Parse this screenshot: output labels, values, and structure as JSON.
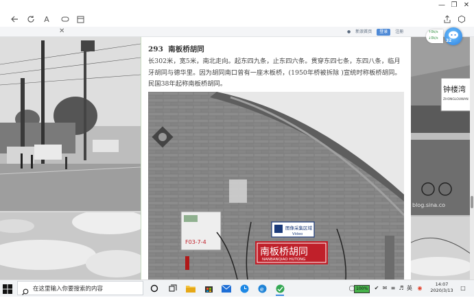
{
  "browser": {
    "toolbar_icons": [
      "back-icon",
      "refresh-icon",
      "read-aloud-icon",
      "vertical-tabs-icon",
      "tab-actions-icon",
      "share-icon",
      "extensions-icon"
    ],
    "text_size_glyph": "A"
  },
  "site_nav": {
    "home": "新浪首页",
    "login": "登录",
    "register": "注册"
  },
  "net_speed": {
    "up": "0k/s",
    "down": "0k/s"
  },
  "assistant_badge": "32",
  "article": {
    "number": "293",
    "title": "南板桥胡同",
    "body": "长302米，宽5米，南北走向。起东四九条，止东四六条。贯穿东四七条，东四八条，临月牙胡同与德华里。因为胡同南口曾有一座木板桥，(1950年桥被拆除 )宣统时称板桥胡同。民国38年起称南板桥胡同。"
  },
  "photo_text": {
    "sign_main": "南板桥胡同",
    "sign_pinyin": "NANBANQIAO HUTONG",
    "camera_notice": "图像采集区域",
    "camera_sub": "Video",
    "meter_label": "F03-7-4",
    "right_sign": "钟楼湾",
    "right_sign_pinyin": "ZHONGLOUWAN",
    "watermark": "blog.sina.co"
  },
  "taskbar": {
    "search_placeholder": "在这里输入你要搜索的内容",
    "battery": "100%",
    "time": "14:07",
    "date": "2020/3/13",
    "ime": "英"
  },
  "colors": {
    "accent": "#4f8ad6",
    "sign_red": "#c0202a",
    "column_border": "#c8ddc0"
  }
}
